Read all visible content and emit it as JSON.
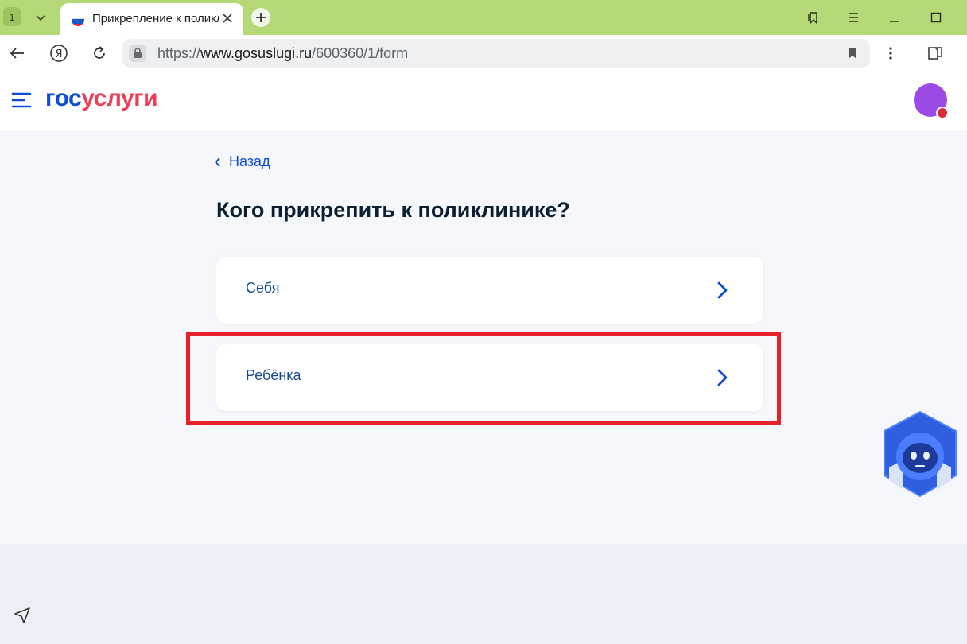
{
  "browser": {
    "tab_count": "1",
    "tab_title": "Прикрепление к поликлинике",
    "url_prefix": "https://",
    "url_host": "www.gosuslugi.ru",
    "url_path": "/600360/1/form",
    "accent_color": "#b6d978"
  },
  "site": {
    "logo_part1": "гос",
    "logo_part2": "услуги",
    "brand_blue": "#0d4cd3",
    "brand_red": "#ee3f58"
  },
  "page": {
    "back_label": "Назад",
    "title": "Кого прикрепить к поликлинике?",
    "options": [
      {
        "label": "Себя"
      },
      {
        "label": "Ребёнка"
      }
    ],
    "highlight_color": "#e8202a"
  }
}
